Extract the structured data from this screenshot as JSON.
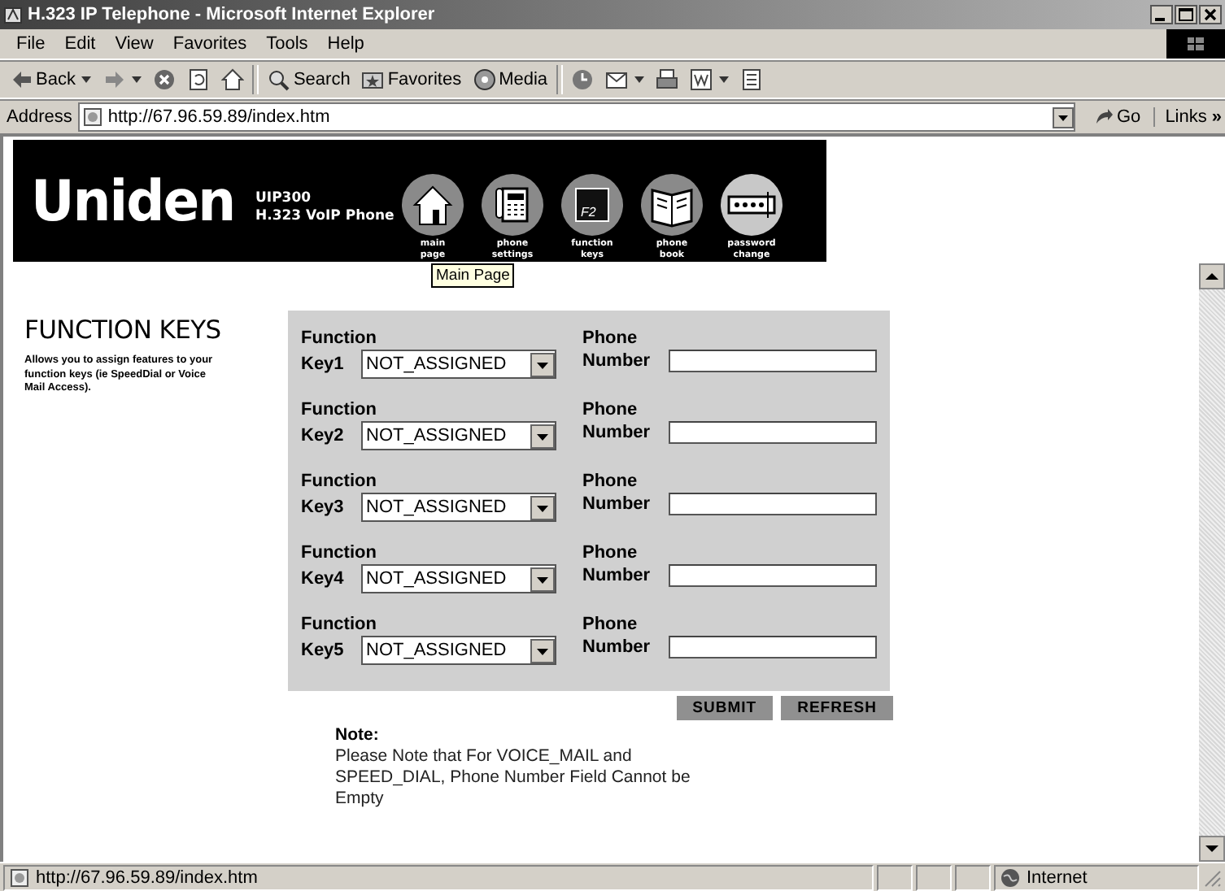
{
  "window": {
    "title": "H.323 IP Telephone - Microsoft Internet Explorer"
  },
  "menu": [
    "File",
    "Edit",
    "View",
    "Favorites",
    "Tools",
    "Help"
  ],
  "toolbar": [
    {
      "kind": "back",
      "label": "Back",
      "dropdown": true
    },
    {
      "kind": "forward",
      "dropdown": true
    },
    {
      "kind": "stop",
      "dropdown": false
    },
    {
      "kind": "refresh",
      "dropdown": false
    },
    {
      "kind": "home",
      "dropdown": false
    },
    {
      "kind": "search",
      "label": "Search",
      "dropdown": false
    },
    {
      "kind": "favorites",
      "label": "Favorites",
      "dropdown": false
    },
    {
      "kind": "media",
      "label": "Media",
      "dropdown": false
    },
    {
      "kind": "history",
      "dropdown": false
    },
    {
      "kind": "mail",
      "dropdown": true
    },
    {
      "kind": "print",
      "dropdown": false
    },
    {
      "kind": "edit",
      "dropdown": true
    },
    {
      "kind": "discuss",
      "dropdown": false
    }
  ],
  "address": {
    "label": "Address",
    "value": "http://67.96.59.89/index.htm",
    "go": "Go",
    "links": "Links",
    "more": "»"
  },
  "header": {
    "brand": "Uniden",
    "model": "UIP300",
    "product": "H.323 VoIP Phone",
    "nav": [
      {
        "kind": "home",
        "label": "main page"
      },
      {
        "kind": "phone",
        "label": "phone settings"
      },
      {
        "kind": "key",
        "glyph": "F2",
        "label": "function keys"
      },
      {
        "kind": "book",
        "label": "phone book"
      },
      {
        "kind": "password",
        "label": "password change"
      }
    ]
  },
  "tooltip": "Main Page",
  "page": {
    "heading": "FUNCTION KEYS",
    "description": "Allows you to assign features to your function keys (ie SpeedDial or Voice Mail Access)."
  },
  "keys": [
    {
      "label_top": "Function",
      "label": "Key1",
      "value": "NOT_ASSIGNED",
      "number_top": "Phone",
      "number_label": "Number"
    },
    {
      "label_top": "Function",
      "label": "Key2",
      "value": "NOT_ASSIGNED",
      "number_top": "Phone",
      "number_label": "Number"
    },
    {
      "label_top": "Function",
      "label": "Key3",
      "value": "NOT_ASSIGNED",
      "number_top": "Phone",
      "number_label": "Number"
    },
    {
      "label_top": "Function",
      "label": "Key4",
      "value": "NOT_ASSIGNED",
      "number_top": "Phone",
      "number_label": "Number"
    },
    {
      "label_top": "Function",
      "label": "Key5",
      "value": "NOT_ASSIGNED",
      "number_top": "Phone",
      "number_label": "Number"
    }
  ],
  "buttons": [
    "SUBMIT",
    "REFRESH"
  ],
  "note": {
    "title": "Note:",
    "text": "Please Note that For VOICE_MAIL and SPEED_DIAL, Phone Number Field Cannot be Empty"
  },
  "status": {
    "url": "http://67.96.59.89/index.htm",
    "zone": "Internet"
  }
}
